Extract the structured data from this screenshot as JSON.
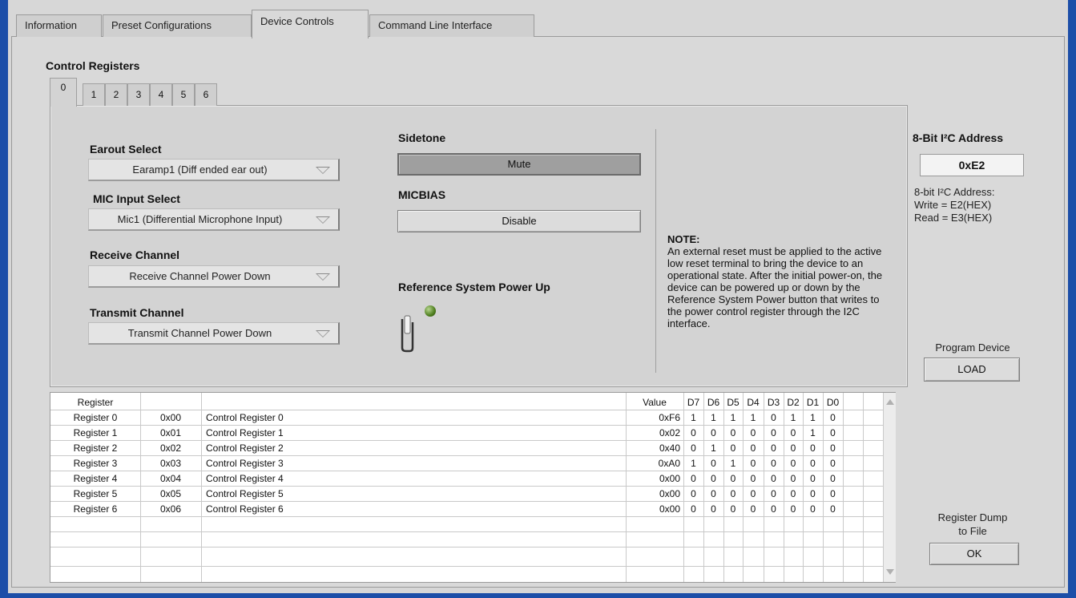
{
  "main_tabs": [
    {
      "label": "Information"
    },
    {
      "label": "Preset Configurations"
    },
    {
      "label": "Device Controls"
    },
    {
      "label": "Command Line Interface"
    }
  ],
  "control_registers_title": "Control Registers",
  "register_tabs": [
    "0",
    "1",
    "2",
    "3",
    "4",
    "5",
    "6"
  ],
  "controls": {
    "earout": {
      "label": "Earout Select",
      "value": "Earamp1 (Diff ended ear out)"
    },
    "mic": {
      "label": "MIC Input Select",
      "value": "Mic1 (Differential Microphone Input)"
    },
    "receive": {
      "label": "Receive Channel",
      "value": "Receive Channel Power Down"
    },
    "transmit": {
      "label": "Transmit Channel",
      "value": "Transmit Channel Power Down"
    },
    "sidetone": {
      "label": "Sidetone",
      "button": "Mute"
    },
    "micbias": {
      "label": "MICBIAS",
      "button": "Disable"
    },
    "power": {
      "label": "Reference System Power Up"
    }
  },
  "note": {
    "title": "NOTE:",
    "text": "An external reset must be applied to the active low reset terminal to bring the device to an operational state. After the initial power-on, the device can be powered up or down by the Reference System Power button that writes to the power control register through the I2C interface."
  },
  "i2c": {
    "title": "8-Bit I²C Address",
    "value": "0xE2",
    "info_line1": "8-bit I²C Address:",
    "info_line2": "Write = E2(HEX)",
    "info_line3": "Read = E3(HEX)"
  },
  "program": {
    "label": "Program Device",
    "button": "LOAD"
  },
  "dump": {
    "label_line1": "Register Dump",
    "label_line2": "to File",
    "button": "OK"
  },
  "table": {
    "headers": [
      "Register",
      "",
      "",
      "Value",
      "D7",
      "D6",
      "D5",
      "D4",
      "D3",
      "D2",
      "D1",
      "D0"
    ],
    "rows": [
      [
        "Register 0",
        "0x00",
        "Control Register 0",
        "0xF6",
        "1",
        "1",
        "1",
        "1",
        "0",
        "1",
        "1",
        "0"
      ],
      [
        "Register 1",
        "0x01",
        "Control Register 1",
        "0x02",
        "0",
        "0",
        "0",
        "0",
        "0",
        "0",
        "1",
        "0"
      ],
      [
        "Register 2",
        "0x02",
        "Control Register 2",
        "0x40",
        "0",
        "1",
        "0",
        "0",
        "0",
        "0",
        "0",
        "0"
      ],
      [
        "Register 3",
        "0x03",
        "Control Register 3",
        "0xA0",
        "1",
        "0",
        "1",
        "0",
        "0",
        "0",
        "0",
        "0"
      ],
      [
        "Register 4",
        "0x04",
        "Control Register 4",
        "0x00",
        "0",
        "0",
        "0",
        "0",
        "0",
        "0",
        "0",
        "0"
      ],
      [
        "Register 5",
        "0x05",
        "Control Register 5",
        "0x00",
        "0",
        "0",
        "0",
        "0",
        "0",
        "0",
        "0",
        "0"
      ],
      [
        "Register 6",
        "0x06",
        "Control Register 6",
        "0x00",
        "0",
        "0",
        "0",
        "0",
        "0",
        "0",
        "0",
        "0"
      ]
    ]
  }
}
